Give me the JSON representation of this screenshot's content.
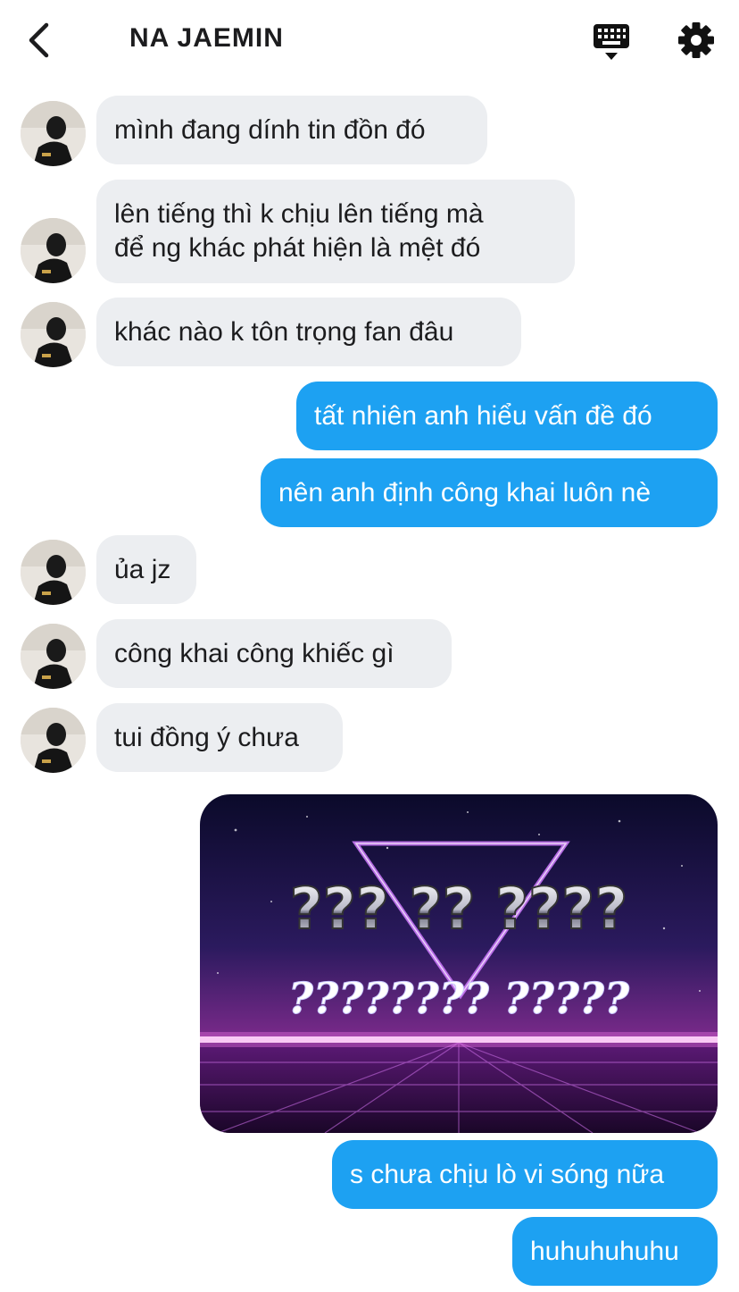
{
  "header": {
    "title": "NA JAEMIN"
  },
  "messages": [
    {
      "side": "in",
      "text": "mình đang dính tin đồn đó"
    },
    {
      "side": "in",
      "line1": "lên tiếng thì k chịu lên tiếng mà",
      "line2": "để ng khác phát hiện là mệt đó"
    },
    {
      "side": "in",
      "text": "khác nào k tôn trọng fan đâu"
    },
    {
      "side": "out",
      "text": "tất nhiên anh hiểu vấn đề đó"
    },
    {
      "side": "out",
      "text": "nên anh định công khai luôn nè"
    },
    {
      "side": "in",
      "text": "ủa jz"
    },
    {
      "side": "in",
      "text": "công khai công khiếc gì"
    },
    {
      "side": "in",
      "text": "tui đồng ý chưa"
    },
    {
      "side": "out",
      "type": "image",
      "meme_top": "??? ?? ????",
      "meme_bottom": "???????? ?????"
    },
    {
      "side": "out",
      "text": "s chưa chịu lò vi sóng nữa"
    },
    {
      "side": "out",
      "text": "huhuhuhuhu"
    }
  ],
  "colors": {
    "outgoing_bubble": "#1da1f2",
    "incoming_bubble": "#eceef1"
  },
  "icons": {
    "back": "chevron-left-icon",
    "keyboard": "keyboard-icon",
    "settings": "gear-icon"
  }
}
